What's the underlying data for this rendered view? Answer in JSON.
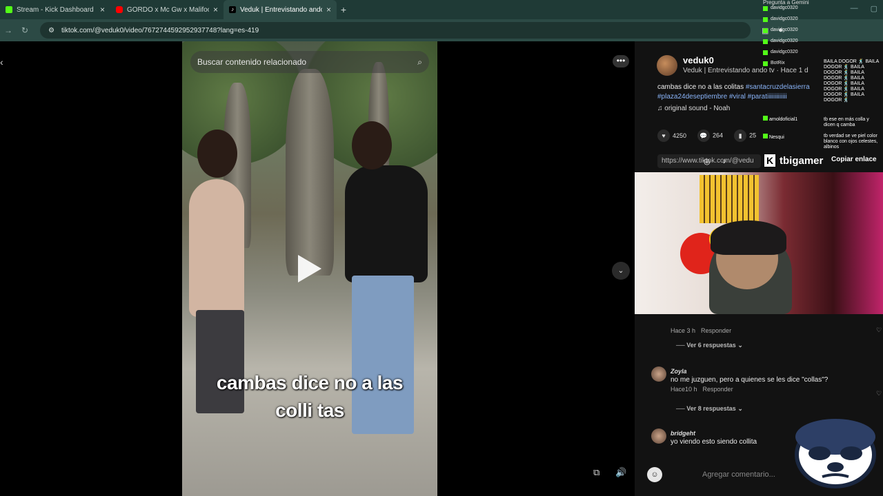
{
  "tabs": [
    {
      "title": "Stream - Kick Dashboard",
      "color": "#53fc18",
      "active": false
    },
    {
      "title": "GORDO x Mc Gw x Malifoo - M",
      "color": "#ff0000",
      "active": false
    },
    {
      "title": "Veduk | Entrevistando ando tv (",
      "color": "#ffffff",
      "active": true
    }
  ],
  "address": {
    "url": "tiktok.com/@veduk0/video/7672744592952937748?lang=es-419"
  },
  "video": {
    "search_placeholder": "Buscar contenido relacionado",
    "caption_line1": "cambas  dice no a las",
    "caption_line2": "colli tas"
  },
  "post": {
    "username": "veduk0",
    "subtitle": "Veduk | Entrevistando ando tv · Hace 1 d",
    "desc_text": "cambas dice no a las colitas ",
    "tags": "#santacruzdelasierra #plaza24deseptiembre #viral #paratiiiiiiiiiiiii",
    "sound": "original sound - Noah",
    "likes": "4250",
    "comments": "264",
    "saves": "25",
    "link": "https://www.tiktok.com/@vedu",
    "copy_link": "Copiar enlace"
  },
  "comments": [
    {
      "meta_time": "Hace 3 h",
      "reply": "Responder",
      "replies": "Ver 6 respuestas"
    },
    {
      "name": "Zoyla",
      "text": "no me juzguen, pero a quienes se les dice \"collas\"?",
      "meta_time": "Hace10 h",
      "reply": "Responder",
      "replies": "Ver 8 respuestas"
    },
    {
      "name": "bridgeht",
      "text": "yo viendo esto siendo collita"
    }
  ],
  "comment_input_placeholder": "Agregar comentario...",
  "chat": {
    "users": [
      "davidgc0320",
      "davidgc0320",
      "davidgc0320",
      "davidgc0320",
      "davidgc0320",
      "BotRix"
    ],
    "extra_users": [
      "arnoldoficial1",
      "Nesqui"
    ],
    "spam_lines": [
      "BAILA DOGOR 🕺 BAILA",
      "DOGOR 🕺 BAILA",
      "DOGOR 🕺 BAILA",
      "DOGOR 🕺 BAILA",
      "DOGOR 🕺 BAILA",
      "DOGOR 🕺 BAILA",
      "DOGOR 🕺 BAILA",
      "DOGOR 🕺"
    ],
    "msg1": "tb ese en más colla y dicen q camba",
    "msg2": "tb verdad se ve piel color blanco con ojos celestes, albinos",
    "top_partial": "Pregunta a Gemini"
  },
  "overlay": {
    "kick_name": "tbigamer"
  }
}
